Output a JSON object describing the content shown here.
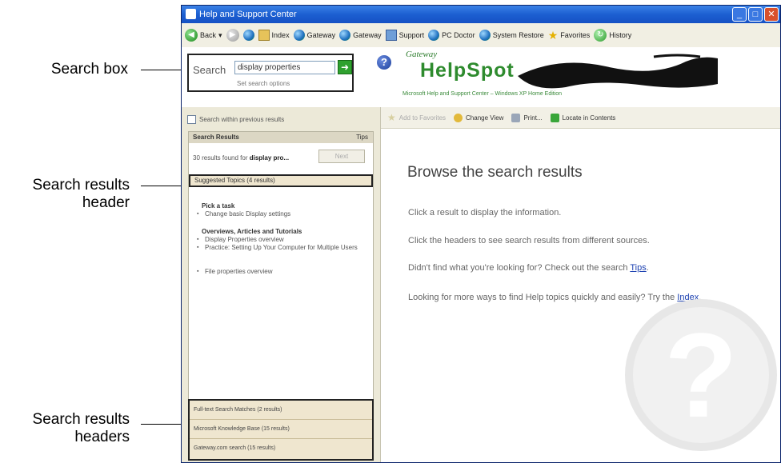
{
  "callouts": {
    "search_box": "Search box",
    "results_header_line1": "Search results",
    "results_header_line2": "header",
    "results_headers_line1": "Search results",
    "results_headers_line2": "headers"
  },
  "window": {
    "title": "Help and Support Center",
    "controls": [
      "_",
      "□",
      "✕"
    ]
  },
  "toolbar": {
    "back": "Back",
    "back_arrow": "▾",
    "index": "Index",
    "favorites": "Favorites",
    "history": "History",
    "items": [
      "Gateway",
      "Gateway",
      "Support",
      "PC Doctor",
      "System Restore"
    ]
  },
  "header": {
    "search_label": "Search",
    "search_value": "display properties",
    "go_symbol": "➜",
    "set_options": "Set search options",
    "help_symbol": "?",
    "brand_gateway": "Gateway",
    "brand_name": "HelpSpot",
    "brand_sub": "Microsoft Help and Support Center – Windows XP Home Edition"
  },
  "left": {
    "prev_results": "Search within previous results",
    "panel_title": "Search Results",
    "panel_tips": "Tips",
    "found_prefix": "30 results found for ",
    "found_query": "display pro...",
    "next_button": "Next",
    "suggested_header": "Suggested Topics (4 results)",
    "group1_title": "Pick a task",
    "group1_items": [
      "Change basic Display settings"
    ],
    "group2_title": "Overviews, Articles and Tutorials",
    "group2_items": [
      "Display Properties overview",
      "Practice: Setting Up Your Computer for Multiple Users",
      "File properties overview"
    ],
    "bottom_headers": [
      "Full-text Search Matches (2 results)",
      "Microsoft Knowledge Base (15 results)",
      "Gateway.com search (15 results)"
    ]
  },
  "right": {
    "toolbar": {
      "add_favorites": "Add to Favorites",
      "change_view": "Change View",
      "print": "Print...",
      "locate": "Locate in Contents"
    },
    "browse_title": "Browse the search results",
    "para1": "Click a result to display the information.",
    "para2": "Click the headers to see search results from different sources.",
    "para3_text": "Didn't find what you're looking for? Check out the search ",
    "para3_link": "Tips",
    "para3_end": ".",
    "para4_text": "Looking for more ways to find Help topics quickly and easily? Try the ",
    "para4_link": "Index",
    "para4_end": ".",
    "watermark_symbol": "?"
  }
}
